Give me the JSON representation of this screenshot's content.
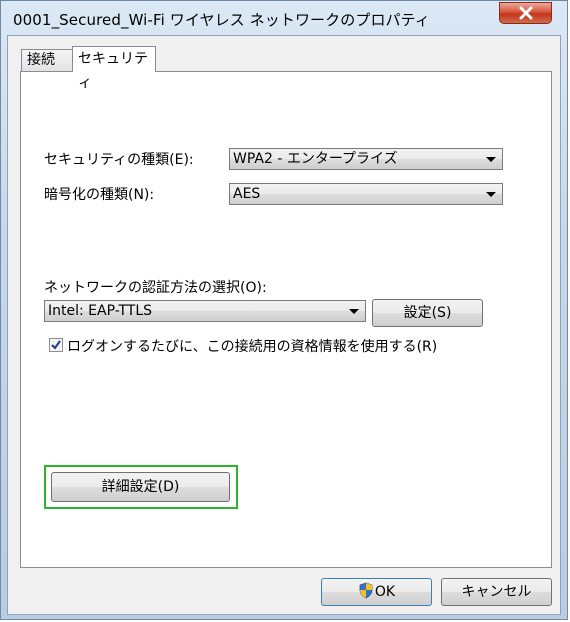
{
  "window": {
    "title": "0001_Secured_Wi-Fi ワイヤレス ネットワークのプロパティ"
  },
  "tabs": [
    {
      "label": "接続",
      "active": false
    },
    {
      "label": "セキュリティ",
      "active": true
    }
  ],
  "security": {
    "security_type_label": "セキュリティの種類(E):",
    "security_type_value": "WPA2 - エンタープライズ",
    "encryption_type_label": "暗号化の種類(N):",
    "encryption_type_value": "AES",
    "auth_method_label": "ネットワークの認証方法の選択(O):",
    "auth_method_value": "Intel: EAP-TTLS",
    "settings_button": "設定(S)",
    "remember_checkbox_label": "ログオンするたびに、この接続用の資格情報を使用する(R)",
    "remember_checked": true,
    "advanced_button": "詳細設定(D)"
  },
  "footer": {
    "ok_button": "OK",
    "cancel_button": "キャンセル"
  },
  "colors": {
    "highlight": "#2cb52c",
    "close_button": "#c3361b"
  }
}
